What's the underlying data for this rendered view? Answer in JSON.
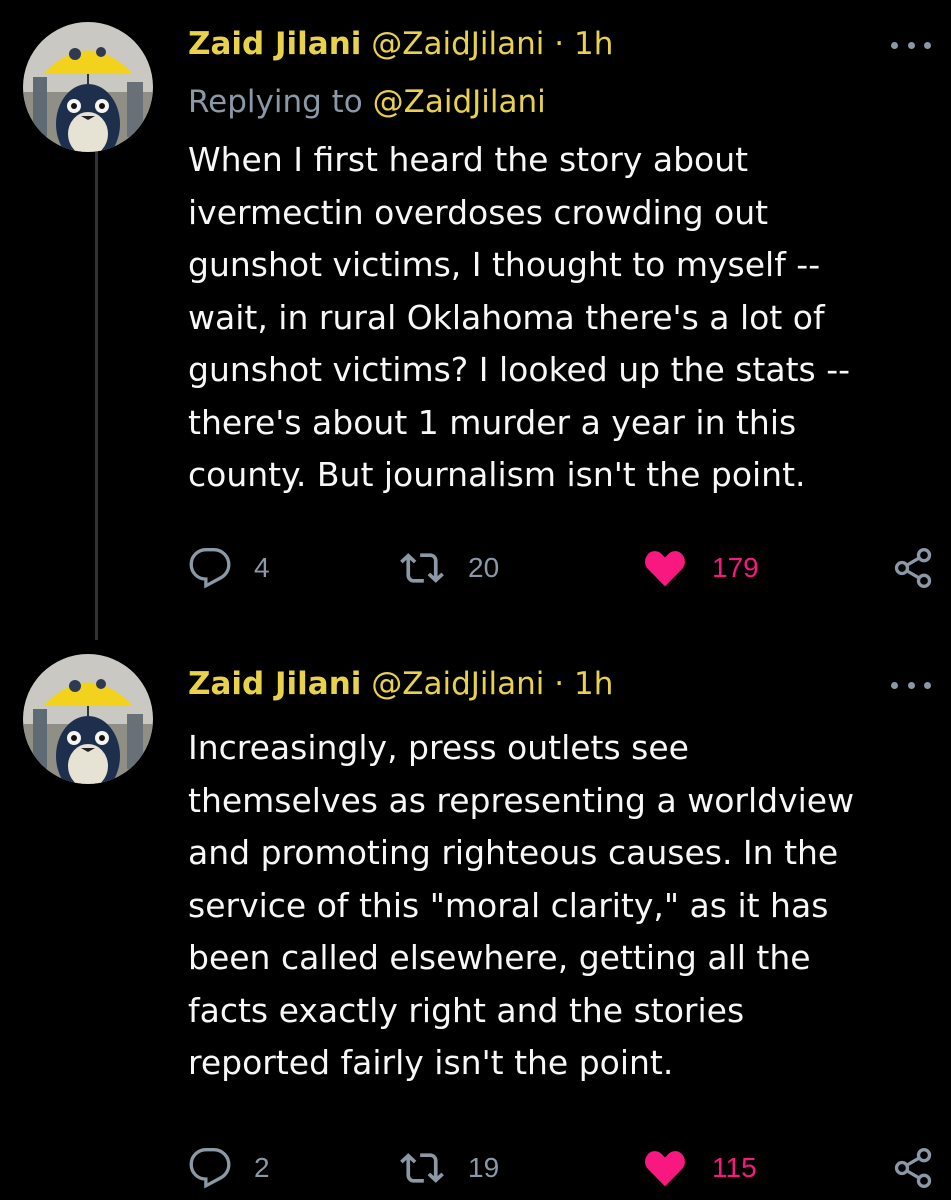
{
  "colors": {
    "background": "#000000",
    "name_yellow": "#e8d24c",
    "muted": "#8b98a5",
    "like_pink": "#f91880",
    "text": "#f7f7f7"
  },
  "tweets": [
    {
      "author_name": "Zaid Jilani",
      "handle": "@ZaidJilani",
      "separator": "·",
      "time": "1h",
      "replying_prefix": "Replying to",
      "replying_to": "@ZaidJilani",
      "text": "When I first heard the story about\nivermectin overdoses crowding out\ngunshot victims, I thought to myself --\nwait, in rural Oklahoma there's a lot of\ngunshot victims? I looked up the stats --\nthere's about 1 murder a year in this\ncounty. But journalism isn't the point.",
      "replies": "4",
      "retweets": "20",
      "likes": "179",
      "liked": true
    },
    {
      "author_name": "Zaid Jilani",
      "handle": "@ZaidJilani",
      "separator": "·",
      "time": "1h",
      "text": "Increasingly, press outlets see\nthemselves as representing a worldview\nand promoting righteous causes. In the\nservice of this \"moral clarity,\" as it has\nbeen called elsewhere, getting all the\nfacts exactly right and the stories\nreported fairly isn't the point.",
      "replies": "2",
      "retweets": "19",
      "likes": "115",
      "liked": true
    }
  ],
  "icons": {
    "reply": "reply-icon",
    "retweet": "retweet-icon",
    "like": "heart-icon",
    "share": "share-icon",
    "more": "more-icon"
  }
}
